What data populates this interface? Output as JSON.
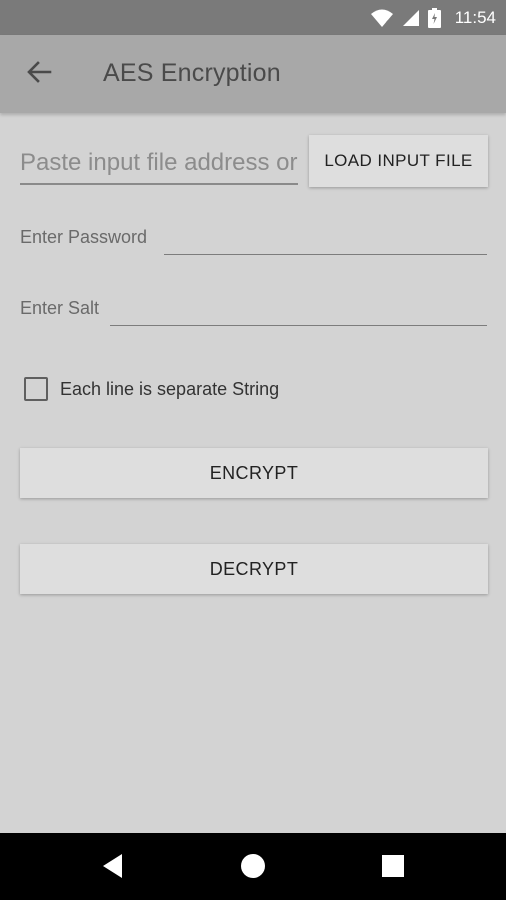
{
  "status_bar": {
    "time": "11:54",
    "icons": [
      "wifi-icon",
      "signal-icon",
      "battery-charging-icon"
    ]
  },
  "app_bar": {
    "title": "AES Encryption",
    "back_icon": "arrow-left-icon"
  },
  "input_file": {
    "placeholder": "Paste input file address or",
    "value": "",
    "load_button_label": "LOAD INPUT FILE"
  },
  "password": {
    "label": "Enter Password",
    "value": ""
  },
  "salt": {
    "label": "Enter Salt",
    "value": ""
  },
  "separate_lines": {
    "label": "Each line is separate String",
    "checked": false
  },
  "actions": {
    "encrypt_label": "ENCRYPT",
    "decrypt_label": "DECRYPT"
  },
  "nav_bar": {
    "icons": [
      "back-triangle-icon",
      "home-circle-icon",
      "recents-square-icon"
    ]
  },
  "colors": {
    "background": "#d3d3d3",
    "status_bar": "#7a7a7a",
    "app_bar": "#a8a8a8",
    "button": "#dedede",
    "nav_bar": "#000000"
  }
}
